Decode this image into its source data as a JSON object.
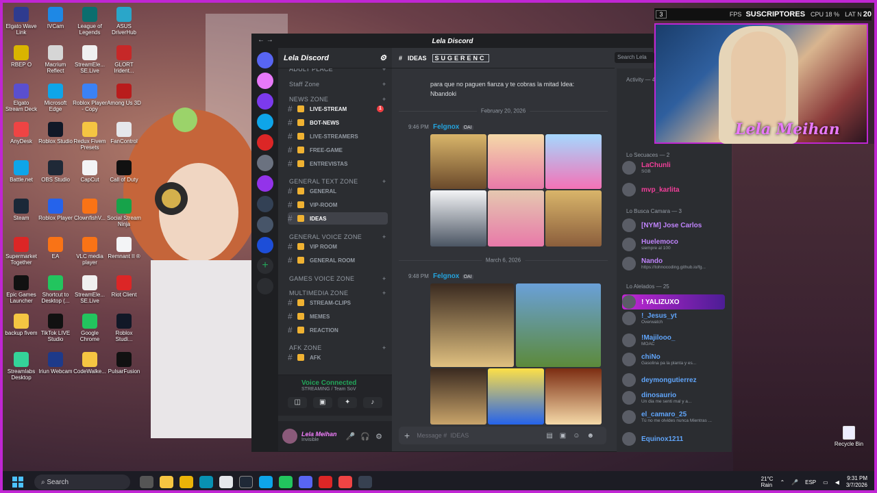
{
  "desktop_icons": [
    {
      "label": "Elgato Wave Link",
      "color": "#2f3b8f"
    },
    {
      "label": "IVCam",
      "color": "#1e88e5"
    },
    {
      "label": "League of Legends",
      "color": "#0b6e6e"
    },
    {
      "label": "ASUS DriverHub",
      "color": "#2aa6c9"
    },
    {
      "label": "RBEP O",
      "color": "#d9b400"
    },
    {
      "label": "Macrium Reflect",
      "color": "#d6d6d6"
    },
    {
      "label": "StreamEle... SE.Live",
      "color": "#f0f0f0"
    },
    {
      "label": "GLORT Irident...",
      "color": "#c62828"
    },
    {
      "label": "Elgato Stream Deck",
      "color": "#5a4fcf"
    },
    {
      "label": "Microsoft Edge",
      "color": "#0ea5e9"
    },
    {
      "label": "Roblox Player - Copy",
      "color": "#3b82f6"
    },
    {
      "label": "Among Us 3D",
      "color": "#b91c1c"
    },
    {
      "label": "AnyDesk",
      "color": "#ef4444"
    },
    {
      "label": "Roblox Studio",
      "color": "#111827"
    },
    {
      "label": "Redux Fivem Presets",
      "color": "#f5c542"
    },
    {
      "label": "FanControl",
      "color": "#e5e7eb"
    },
    {
      "label": "Battle.net",
      "color": "#0ea5e9"
    },
    {
      "label": "OBS Studio",
      "color": "#1f2937"
    },
    {
      "label": "CapCut",
      "color": "#f3f4f6"
    },
    {
      "label": "Call of Duty",
      "color": "#111111"
    },
    {
      "label": "Steam",
      "color": "#1b2838"
    },
    {
      "label": "Roblox Player",
      "color": "#2563eb"
    },
    {
      "label": "ClownfishV...",
      "color": "#f97316"
    },
    {
      "label": "Social Stream Ninja",
      "color": "#16a34a"
    },
    {
      "label": "Supermarket Together",
      "color": "#dc2626"
    },
    {
      "label": "EA",
      "color": "#f97316"
    },
    {
      "label": "VLC media player",
      "color": "#f97316"
    },
    {
      "label": "Remnant II ®",
      "color": "#f3f4f6"
    },
    {
      "label": "Epic Games Launcher",
      "color": "#111111"
    },
    {
      "label": "Shortcut to Desktop (...",
      "color": "#22c55e"
    },
    {
      "label": "StreamEle... SE.Live",
      "color": "#f0f0f0"
    },
    {
      "label": "Riot Client",
      "color": "#dc2626"
    },
    {
      "label": "backup fivem",
      "color": "#f5c542"
    },
    {
      "label": "TikTok LIVE Studio",
      "color": "#111111"
    },
    {
      "label": "Google Chrome",
      "color": "#22c55e"
    },
    {
      "label": "Roblox Studi...",
      "color": "#111827"
    },
    {
      "label": "Streamlabs Desktop",
      "color": "#34d399"
    },
    {
      "label": "Iriun Webcam",
      "color": "#1e3a8a"
    },
    {
      "label": "CodeWalke...",
      "color": "#f5c542"
    },
    {
      "label": "PulsarFusion",
      "color": "#111111"
    }
  ],
  "discord": {
    "window_title": "Lela Discord",
    "server_name": "Lela Discord",
    "categories": [
      {
        "label": "ADULT PLACE"
      },
      {
        "label": "Staff Zone"
      },
      {
        "label": "NEWS ZONE"
      },
      {
        "label": "GENERAL TEXT ZONE"
      },
      {
        "label": "GENERAL VOICE ZONE"
      },
      {
        "label": "GAMES VOICE ZONE"
      },
      {
        "label": "MULTIMEDIA ZONE"
      },
      {
        "label": "AFK ZONE"
      }
    ],
    "channels": [
      {
        "label": "LIVE-STREAM",
        "badge": "1"
      },
      {
        "label": "BOT-NEWS"
      },
      {
        "label": "LIVE-STREAMERS"
      },
      {
        "label": "FREE-GAME"
      },
      {
        "label": "ENTREVISTAS"
      },
      {
        "label": "GENERAL"
      },
      {
        "label": "VIP-ROOM"
      },
      {
        "label": "IDEAS"
      },
      {
        "label": "VIP ROOM"
      },
      {
        "label": "GENERAL ROOM"
      },
      {
        "label": "STREAM-CLIPS"
      },
      {
        "label": "MEMES"
      },
      {
        "label": "REACTION"
      },
      {
        "label": "AFK"
      }
    ],
    "voice": {
      "status": "Voice Connected",
      "sub": "STREAMING / Team SoV"
    },
    "user": {
      "name": "Lela Meihan",
      "status": "Invisible"
    },
    "chat": {
      "channel": "IDEAS",
      "header_tag": "SUGERENC",
      "search_placeholder": "Search Lela",
      "intro_text": "para que no paguen fianza y te cobras la mitad Idea: Nbandoki",
      "date1": "February 20, 2026",
      "msg1_time": "9:46 PM",
      "msg1_author": "Felgnox",
      "msg1_tag": "OAI",
      "date2": "March 6, 2026",
      "msg2_time": "9:48 PM",
      "msg2_author": "Felgnox",
      "msg2_tag": "OAI",
      "composer_placeholder": "Message #",
      "composer_channel": "IDEAS"
    },
    "members": {
      "activity_label": "Activity — 4",
      "sections": [
        {
          "label": "Lo Secuaces — 2"
        },
        {
          "label": "Lo Busca Camara — 3"
        },
        {
          "label": "Lo Alelados — 25"
        }
      ],
      "list": [
        {
          "name": "LaChunli",
          "sub": "SGB",
          "color": "#f23f9a"
        },
        {
          "name": "mvp_karlita",
          "sub": "",
          "color": "#f23f9a"
        },
        {
          "name": "[NYM] Jose Carlos",
          "sub": "",
          "color": "#c084fc"
        },
        {
          "name": "Huelemoco",
          "sub": "siempre al 100",
          "color": "#c084fc"
        },
        {
          "name": "Nando",
          "sub": "https://tohnocoding.github.io/fg...",
          "color": "#c084fc"
        },
        {
          "name": "! YALIZUXO",
          "sub": "",
          "color": "#ffffff"
        },
        {
          "name": "!_Jesus_yt",
          "sub": "Overwatch",
          "color": "#60a5fa"
        },
        {
          "name": "!Majilooo_",
          "sub": "MOAC",
          "color": "#60a5fa"
        },
        {
          "name": "chiNo",
          "sub": "Gasolina pa la planta y es...",
          "color": "#60a5fa"
        },
        {
          "name": "deymongutierrez",
          "sub": "",
          "color": "#60a5fa"
        },
        {
          "name": "dinosaurio",
          "sub": "Un dia me senti mal y a...",
          "color": "#60a5fa"
        },
        {
          "name": "el_camaro_25",
          "sub": "Tú no me olvides nunca Mientras ...",
          "color": "#60a5fa"
        },
        {
          "name": "Equinox1211",
          "sub": "",
          "color": "#60a5fa"
        }
      ]
    }
  },
  "overlay": {
    "count": "3",
    "fps": "FPS",
    "subscribers": "SUSCRIPTORES",
    "cpu": "CPU 18 %",
    "lat": "LAT N",
    "lat_value": "20"
  },
  "webcam_logo": "Lela Meihan",
  "recycle_bin": "Recycle Bin",
  "taskbar": {
    "search": "Search",
    "weather_temp": "21°C",
    "weather_desc": "Rain",
    "lang": "ESP",
    "time": "9:31 PM",
    "date": "3/7/2026"
  }
}
